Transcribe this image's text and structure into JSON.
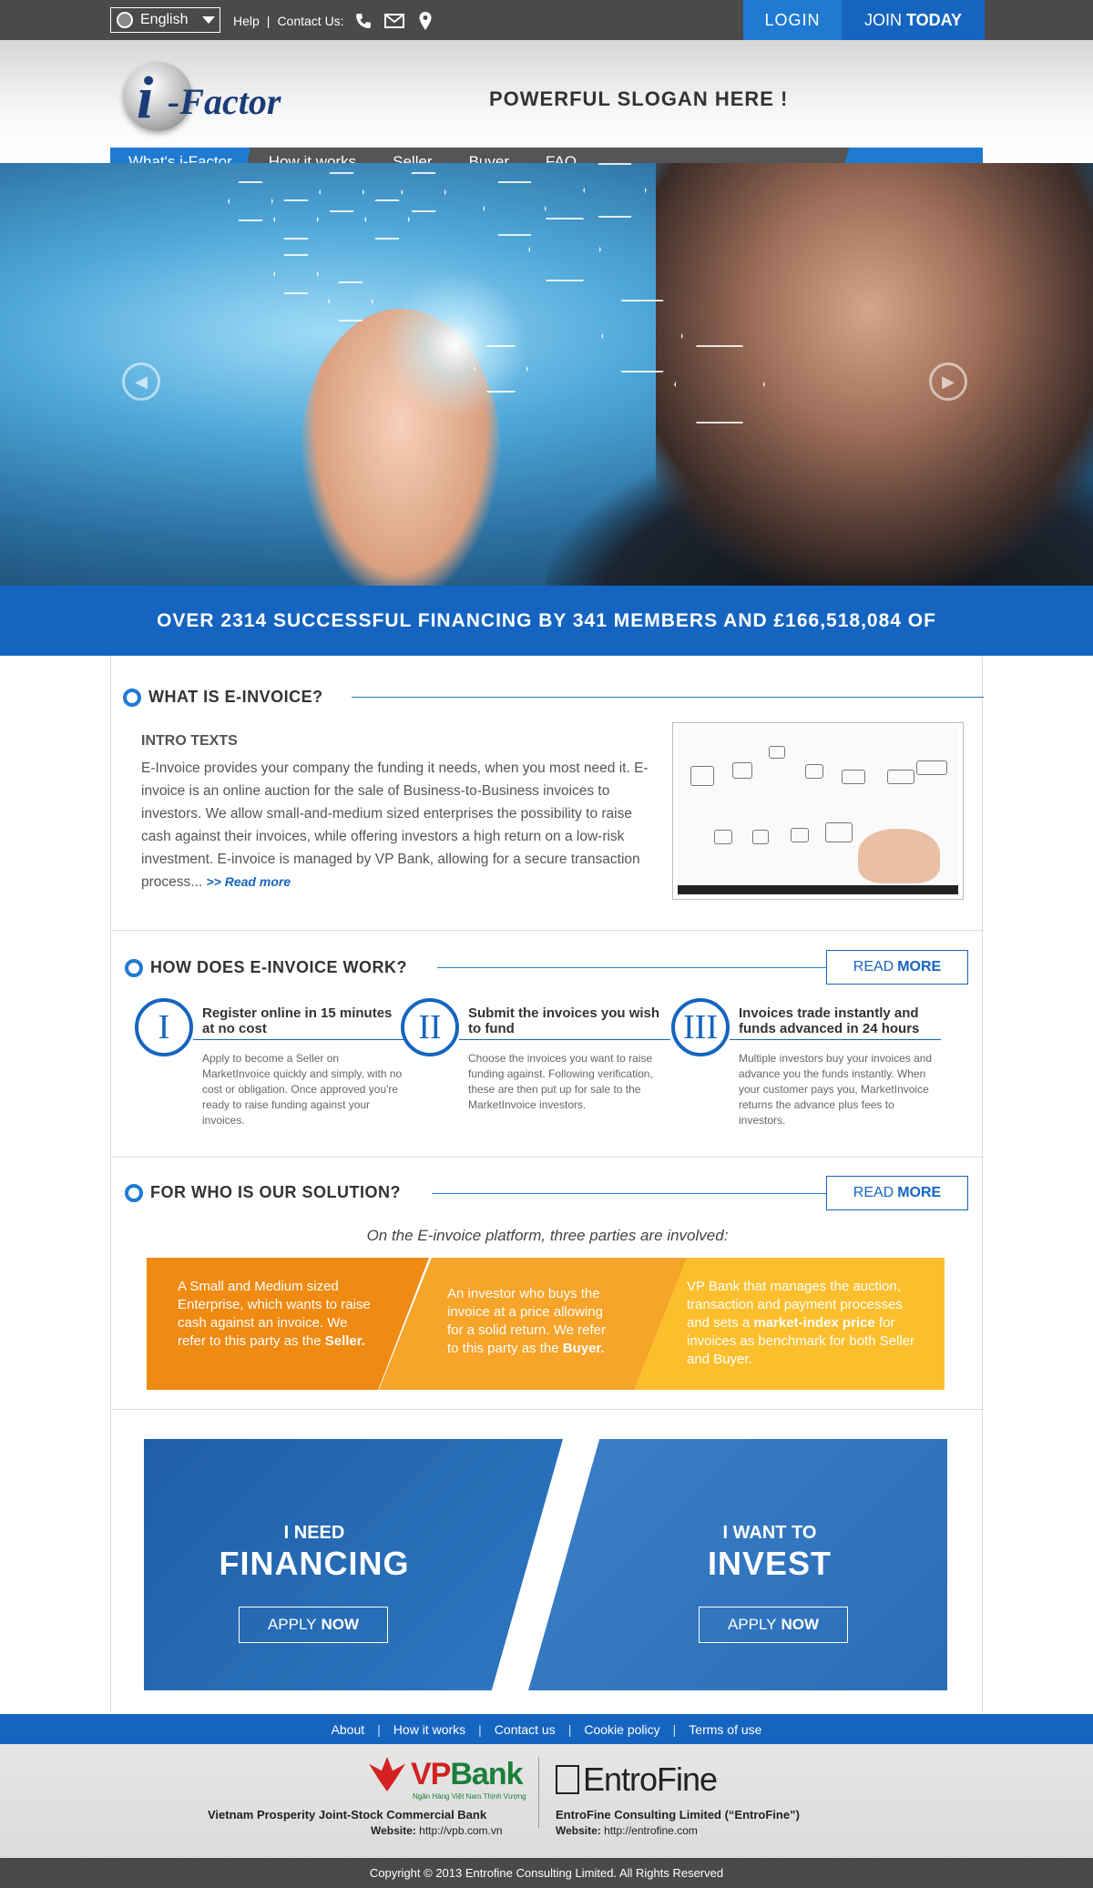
{
  "topbar": {
    "language": "English",
    "help": "Help",
    "separator": "|",
    "contact_label": "Contact Us:",
    "icons": [
      "phone-icon",
      "mail-icon",
      "location-pin-icon"
    ],
    "login": "LOGIN",
    "join_prefix": "JOIN",
    "join_bold": "TODAY"
  },
  "header": {
    "logo_i": "i",
    "logo_text": "-Factor",
    "slogan": "POWERFUL SLOGAN HERE !"
  },
  "nav": {
    "items": [
      "What's i-Factor",
      "How it works",
      "Seller",
      "Buyer",
      "FAQ"
    ],
    "active_index": 0
  },
  "hero": {
    "prev_icon": "arrow-left-circle-icon",
    "next_icon": "arrow-right-circle-icon"
  },
  "banner": {
    "text": "OVER 2314 SUCCESSFUL FINANCING BY 341 MEMBERS AND £166,518,084 OF"
  },
  "einvoice": {
    "title": "WHAT IS E-INVOICE?",
    "intro_heading": "INTRO TEXTS",
    "intro_body": "E-Invoice provides your company the funding it needs, when you most need it.  E-invoice is an online auction for the sale of Business-to-Business invoices to investors.  We allow small-and-medium sized enterprises the possibility to raise cash against their invoices, while offering investors a high return on a low-risk investment. E-invoice is managed by VP Bank, allowing for a secure transaction process... ",
    "read_more": ">> Read more"
  },
  "how": {
    "title": "HOW DOES E-INVOICE WORK?",
    "read_label": "READ",
    "more_label": "MORE",
    "steps": [
      {
        "numeral": "I",
        "title": "Register online in 15 minutes at no cost",
        "text": "Apply to become a Seller on MarketInvoice quickly and simply, with no cost or obligation. Once approved you're ready to raise funding against your invoices."
      },
      {
        "numeral": "II",
        "title": "Submit the invoices you wish to fund",
        "text": "Choose the invoices you want to raise funding against. Following verification, these are then put up for sale to the MarketInvoice investors."
      },
      {
        "numeral": "III",
        "title": "Invoices trade instantly and funds advanced in 24 hours",
        "text": "Multiple investors buy your invoices and advance you the funds instantly. When your customer pays you, MarketInvoice returns the advance plus fees to investors."
      }
    ]
  },
  "who": {
    "title": "FOR WHO IS OUR SOLUTION?",
    "read_label": "READ",
    "more_label": "MORE",
    "intro": "On the E-invoice platform, three parties are involved:",
    "parties": [
      {
        "text": "A Small and Medium sized Enterprise, which wants to raise cash against an invoice.  We refer to this party as the ",
        "bold": "Seller.",
        "after": "",
        "color": "#ef8a12"
      },
      {
        "text": "An investor who buys the invoice at a price allowing for a solid return. We refer to this party as the ",
        "bold": "Buyer.",
        "after": "",
        "color": "#f6a42a"
      },
      {
        "text": "VP Bank that manages the auction, transaction and payment processes and sets a ",
        "bold": "market-index price",
        "after": " for invoices as benchmark for both Seller and Buyer.",
        "color": "#fbbf2e"
      }
    ]
  },
  "cta": {
    "left_small": "I NEED",
    "left_big": "FINANCING",
    "right_small": "I WANT TO",
    "right_big": "INVEST",
    "apply": "APPLY",
    "now": "NOW"
  },
  "footer": {
    "links": [
      "About",
      "How it works",
      "Contact us",
      "Cookie policy",
      "Terms of use"
    ],
    "link_separator": "|",
    "vp_logo_left": "VP",
    "vp_logo_right": "Bank",
    "vp_tagline": "Ngân Hàng Việt Nam Thịnh Vượng",
    "vp_name": "Vietnam Prosperity Joint-Stock Commercial Bank",
    "vp_site_label": "Website:",
    "vp_site": "http://vpb.com.vn",
    "ef_logo": "EntroFine",
    "ef_name": "EntroFine Consulting Limited (“EntroFine”)",
    "ef_site_label": "Website:",
    "ef_site": "http://entrofine.com",
    "copyright": "Copyright © 2013 Entrofine Consulting Limited. All Rights Reserved"
  },
  "colors": {
    "brand_blue": "#1565c0",
    "accent_blue": "#1f7bd1",
    "dark_bar": "#4a4a4a"
  }
}
